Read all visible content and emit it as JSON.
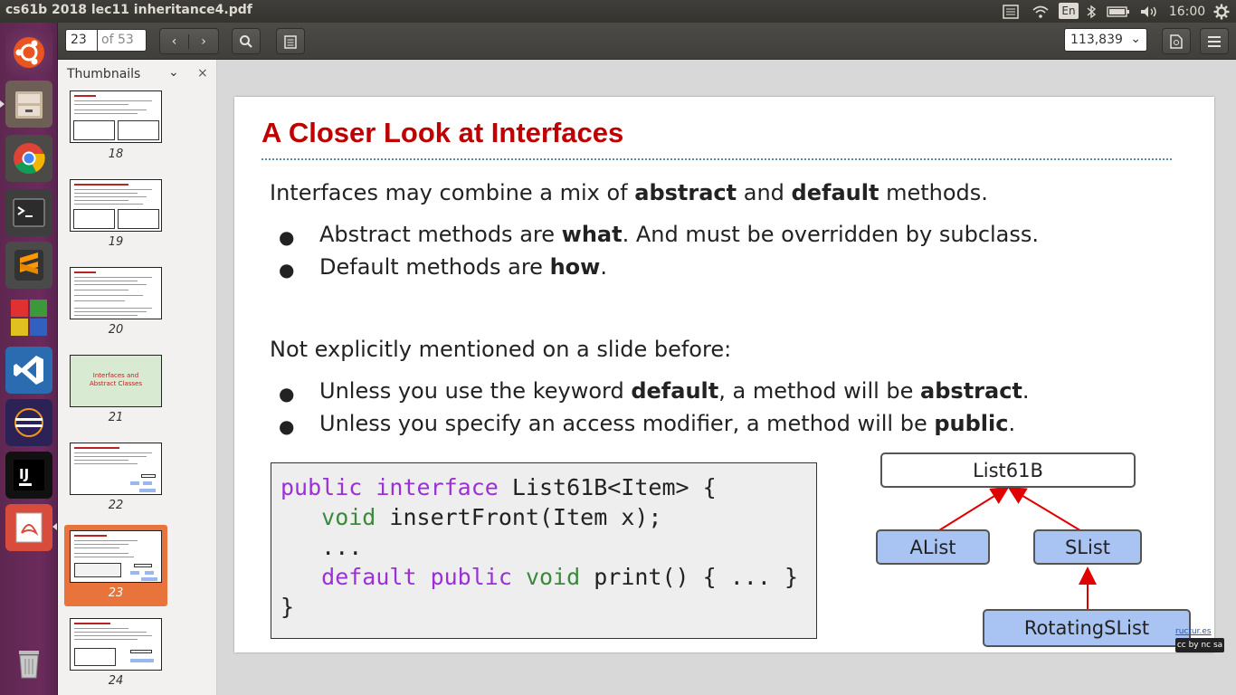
{
  "window": {
    "title": "cs61b 2018 lec11 inheritance4.pdf"
  },
  "tray": {
    "lang": "En",
    "time": "16:00"
  },
  "toolbar": {
    "page_value": "23",
    "page_total": "of 53",
    "zoom": "113,839"
  },
  "sidebar": {
    "header": "Thumbnails",
    "thumbnails": [
      {
        "num": "18"
      },
      {
        "num": "19"
      },
      {
        "num": "20"
      },
      {
        "num": "21",
        "title_line1": "Interfaces and",
        "title_line2": "Abstract Classes"
      },
      {
        "num": "22"
      },
      {
        "num": "23"
      },
      {
        "num": "24"
      }
    ]
  },
  "slide": {
    "title": "A Closer Look at Interfaces",
    "intro": {
      "pre": "Interfaces may combine a mix of ",
      "b1": "abstract",
      "mid": " and ",
      "b2": "default",
      "post": " methods."
    },
    "bullets1": [
      {
        "pre": "Abstract methods are ",
        "b": "what",
        "post": ". And must be overridden by subclass."
      },
      {
        "pre": "Default methods are ",
        "b": "how",
        "post": "."
      }
    ],
    "intro2": "Not explicitly mentioned on a slide before:",
    "bullets2": [
      {
        "pre": "Unless you use the keyword ",
        "b1": "default",
        "mid": ", a method will be ",
        "b2": "abstract",
        "post": "."
      },
      {
        "pre": "Unless you specify an access modifier, a method will be ",
        "b": "public",
        "post": "."
      }
    ],
    "code": {
      "kw_public": "public",
      "kw_interface": "interface",
      "decl": " List61B<Item> {",
      "kw_void": "void",
      "insert": " insertFront(Item x);",
      "ellipsis": "...",
      "kw_default": "default",
      "print": " print() { ... }",
      "close": "}"
    },
    "diagram": {
      "root": "List61B",
      "left": "AList",
      "right": "SList",
      "bottom": "RotatingSList"
    },
    "license_link": "ructur.es",
    "license_badge": "cc by nc sa"
  }
}
